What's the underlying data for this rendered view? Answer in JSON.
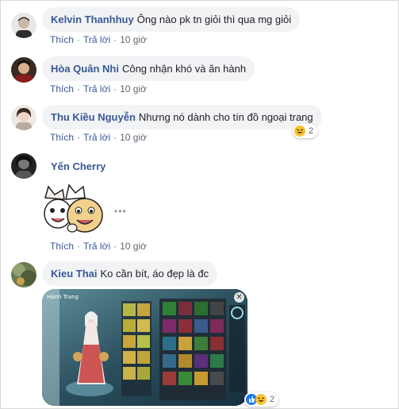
{
  "actions": {
    "like": "Thích",
    "reply": "Trả lời",
    "dot": "·"
  },
  "comments": [
    {
      "author": "Kelvin Thanhhuy",
      "text": "Ông nào pk tn giỏi thì qua mg giỏi",
      "time": "10 giờ"
    },
    {
      "author": "Hòa Quân Nhi",
      "text": "Công nhận khó và ăn hành",
      "time": "10 giờ"
    },
    {
      "author": "Thu Kiều Nguyễn",
      "text": "Nhưng nó dành cho tín đồ ngoại trang",
      "time": "10 giờ",
      "reactions": {
        "icons": [
          "haha"
        ],
        "count": "2"
      }
    },
    {
      "author": "Yến Cherry",
      "text": "",
      "time": "10 giờ",
      "sticker": "cartoon-cats-sticker",
      "more": "•••"
    },
    {
      "author": "Kieu Thai",
      "text": "Ko cần bít, áo đẹp là đc",
      "image": "game-inventory-screenshot",
      "image_text": "Hành Trang",
      "reactions": {
        "icons": [
          "like",
          "haha"
        ],
        "count": "2"
      }
    }
  ],
  "colors": {
    "author": "#385898",
    "bubble": "#f2f3f5",
    "meta": "#606770"
  }
}
